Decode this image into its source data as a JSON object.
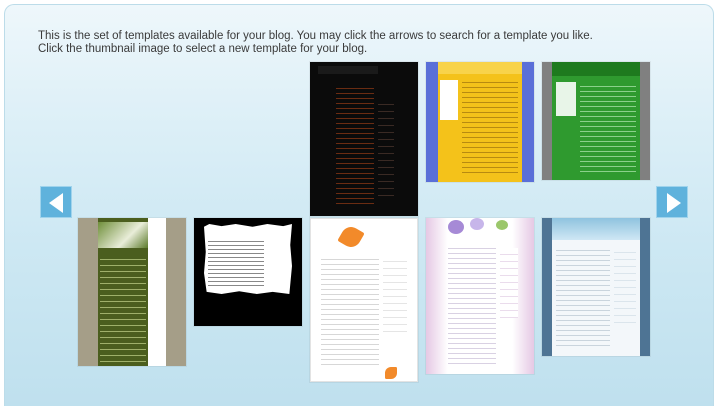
{
  "intro": {
    "line1": "This is the set of templates available for your blog. You may click the arrows to search for a template you like.",
    "line2": "Click the thumbnail image to select a new template for your blog."
  },
  "nav": {
    "prev_icon": "left-arrow-icon",
    "next_icon": "right-arrow-icon",
    "accent": "#5fb2dc"
  },
  "templates": [
    {
      "name": "template-dark-orange",
      "colors": [
        "#0a0a0a",
        "#5b2410"
      ]
    },
    {
      "name": "template-yellow-blue",
      "colors": [
        "#f4c21a",
        "#5a6fd8"
      ]
    },
    {
      "name": "template-green",
      "colors": [
        "#2f9a2f",
        "#808080"
      ]
    },
    {
      "name": "template-olive-photo",
      "colors": [
        "#4b5e1e",
        "#a59e88"
      ]
    },
    {
      "name": "template-black-ink",
      "colors": [
        "#000000",
        "#ffffff"
      ]
    },
    {
      "name": "template-orange-flower",
      "colors": [
        "#ffffff",
        "#f28a2a"
      ]
    },
    {
      "name": "template-purple-flower",
      "colors": [
        "#ffffff",
        "#e5c8e4"
      ]
    },
    {
      "name": "template-sky-blue",
      "colors": [
        "#8fc3df",
        "#4e7494"
      ]
    }
  ]
}
